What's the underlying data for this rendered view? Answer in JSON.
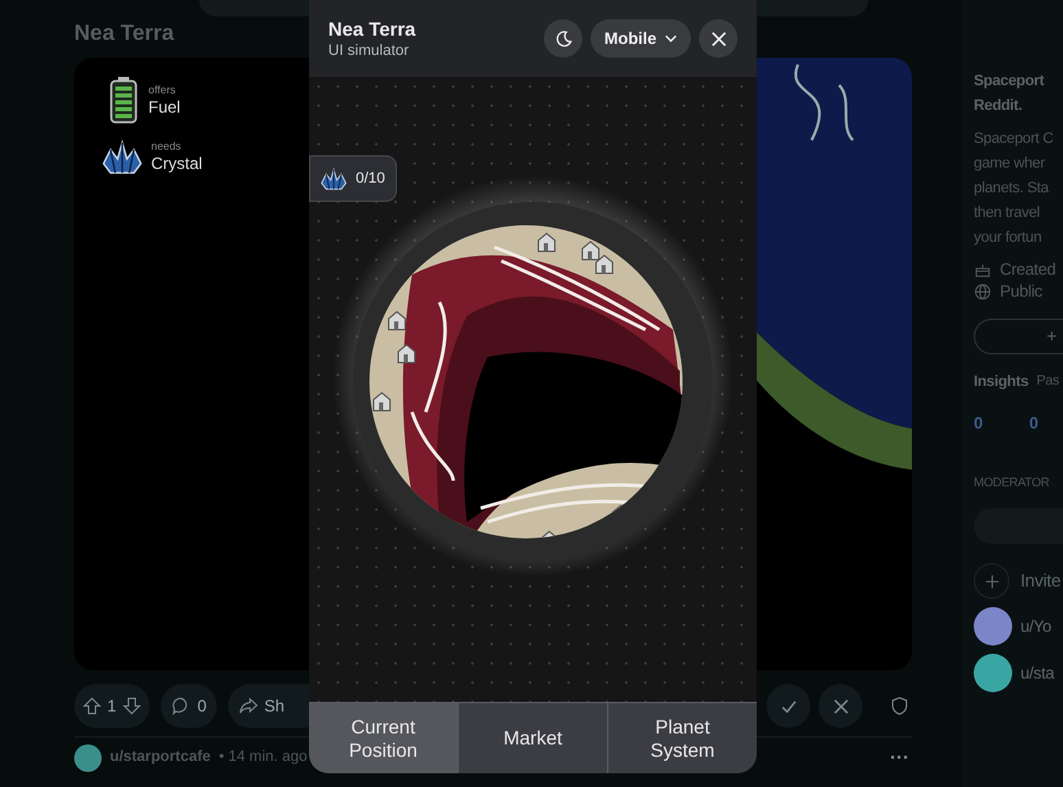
{
  "post": {
    "title": "Nea Terra",
    "game": {
      "offer": {
        "caption": "offers",
        "resource": "Fuel"
      },
      "need": {
        "caption": "needs",
        "resource": "Crystal"
      }
    },
    "actions": {
      "votes": "1",
      "comments": "0",
      "share": "Sh"
    },
    "author": {
      "name": "u/starportcafe",
      "time": "• 14 min. ago",
      "more": "···"
    }
  },
  "sidebar": {
    "title_lines": [
      "Spaceport",
      "Reddit."
    ],
    "description_lines": [
      "Spaceport C",
      "game wher",
      "planets. Sta",
      "then travel",
      "your fortun"
    ],
    "meta": [
      {
        "kind": "created",
        "text": "Created"
      },
      {
        "kind": "public",
        "text": "Public"
      }
    ],
    "join_button": "+",
    "insights": {
      "label": "Insights",
      "sub": "Pas",
      "values": [
        "0",
        "0"
      ]
    },
    "moderators_heading": "MODERATOR",
    "invite": "Invite",
    "moderators": [
      {
        "name": "u/Yo",
        "color": "#7b86c9"
      },
      {
        "name": "u/sta",
        "color": "#3aa6a3"
      }
    ]
  },
  "simulator": {
    "title": "Nea Terra",
    "subtitle": "UI simulator",
    "device": "Mobile",
    "crystal_counter": "0/10",
    "tabs": [
      {
        "label": "Current Position",
        "selected": true
      },
      {
        "label": "Market",
        "selected": false
      },
      {
        "label": "Planet System",
        "selected": false
      }
    ]
  }
}
